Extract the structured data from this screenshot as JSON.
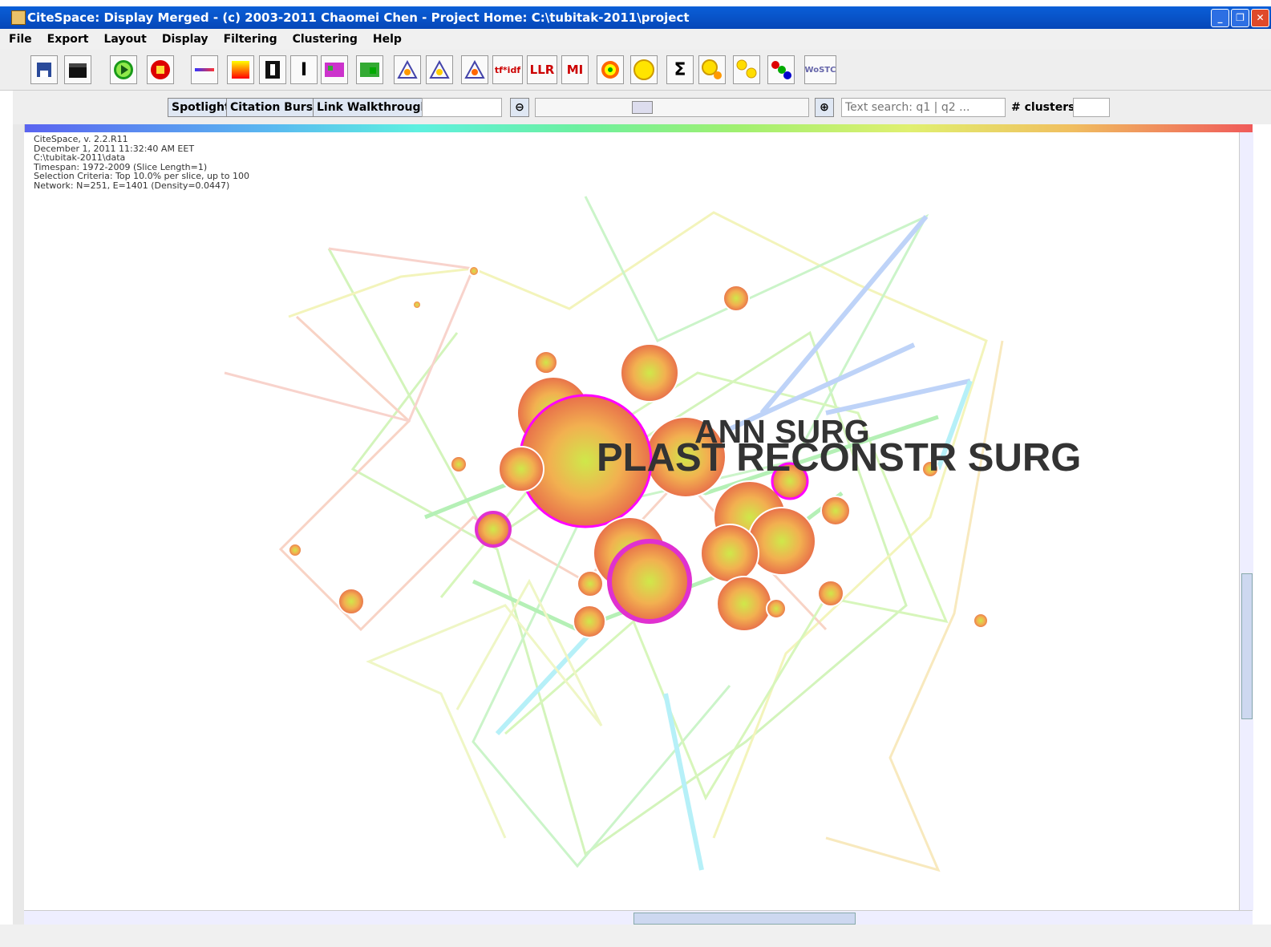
{
  "window": {
    "title": "CiteSpace: Display Merged - (c) 2003-2011 Chaomei Chen - Project Home: C:\\tubitak-2011\\project",
    "buttons": [
      "minimize",
      "maximize",
      "close"
    ]
  },
  "menu": [
    "File",
    "Export",
    "Layout",
    "Display",
    "Filtering",
    "Clustering",
    "Help"
  ],
  "toolbar": {
    "tfidf_label": "tf*idf",
    "llr_label": "LLR",
    "mi_label": "MI",
    "sigma_label": "Σ",
    "wos_label": "WoSTC"
  },
  "controls": {
    "spotlight": "Spotlight",
    "citation_burst": "Citation Burst",
    "link_walkthrough": "Link Walkthrough",
    "search_placeholder": "Text search: q1 | q2 ...",
    "clusters_label": "# clusters"
  },
  "info": {
    "line1": "CiteSpace, v. 2.2.R11",
    "line2": "December 1, 2011 11:32:40 AM EET",
    "line3": "C:\\tubitak-2011\\data",
    "line4": "Timespan: 1972-2009 (Slice Length=1)",
    "line5": "Selection Criteria: Top 10.0% per slice, up to 100",
    "line6": "Network: N=251, E=1401 (Density=0.0447)"
  },
  "network": {
    "label_ann": "ANN SURG",
    "label_plast": "PLAST RECONSTR SURG"
  }
}
